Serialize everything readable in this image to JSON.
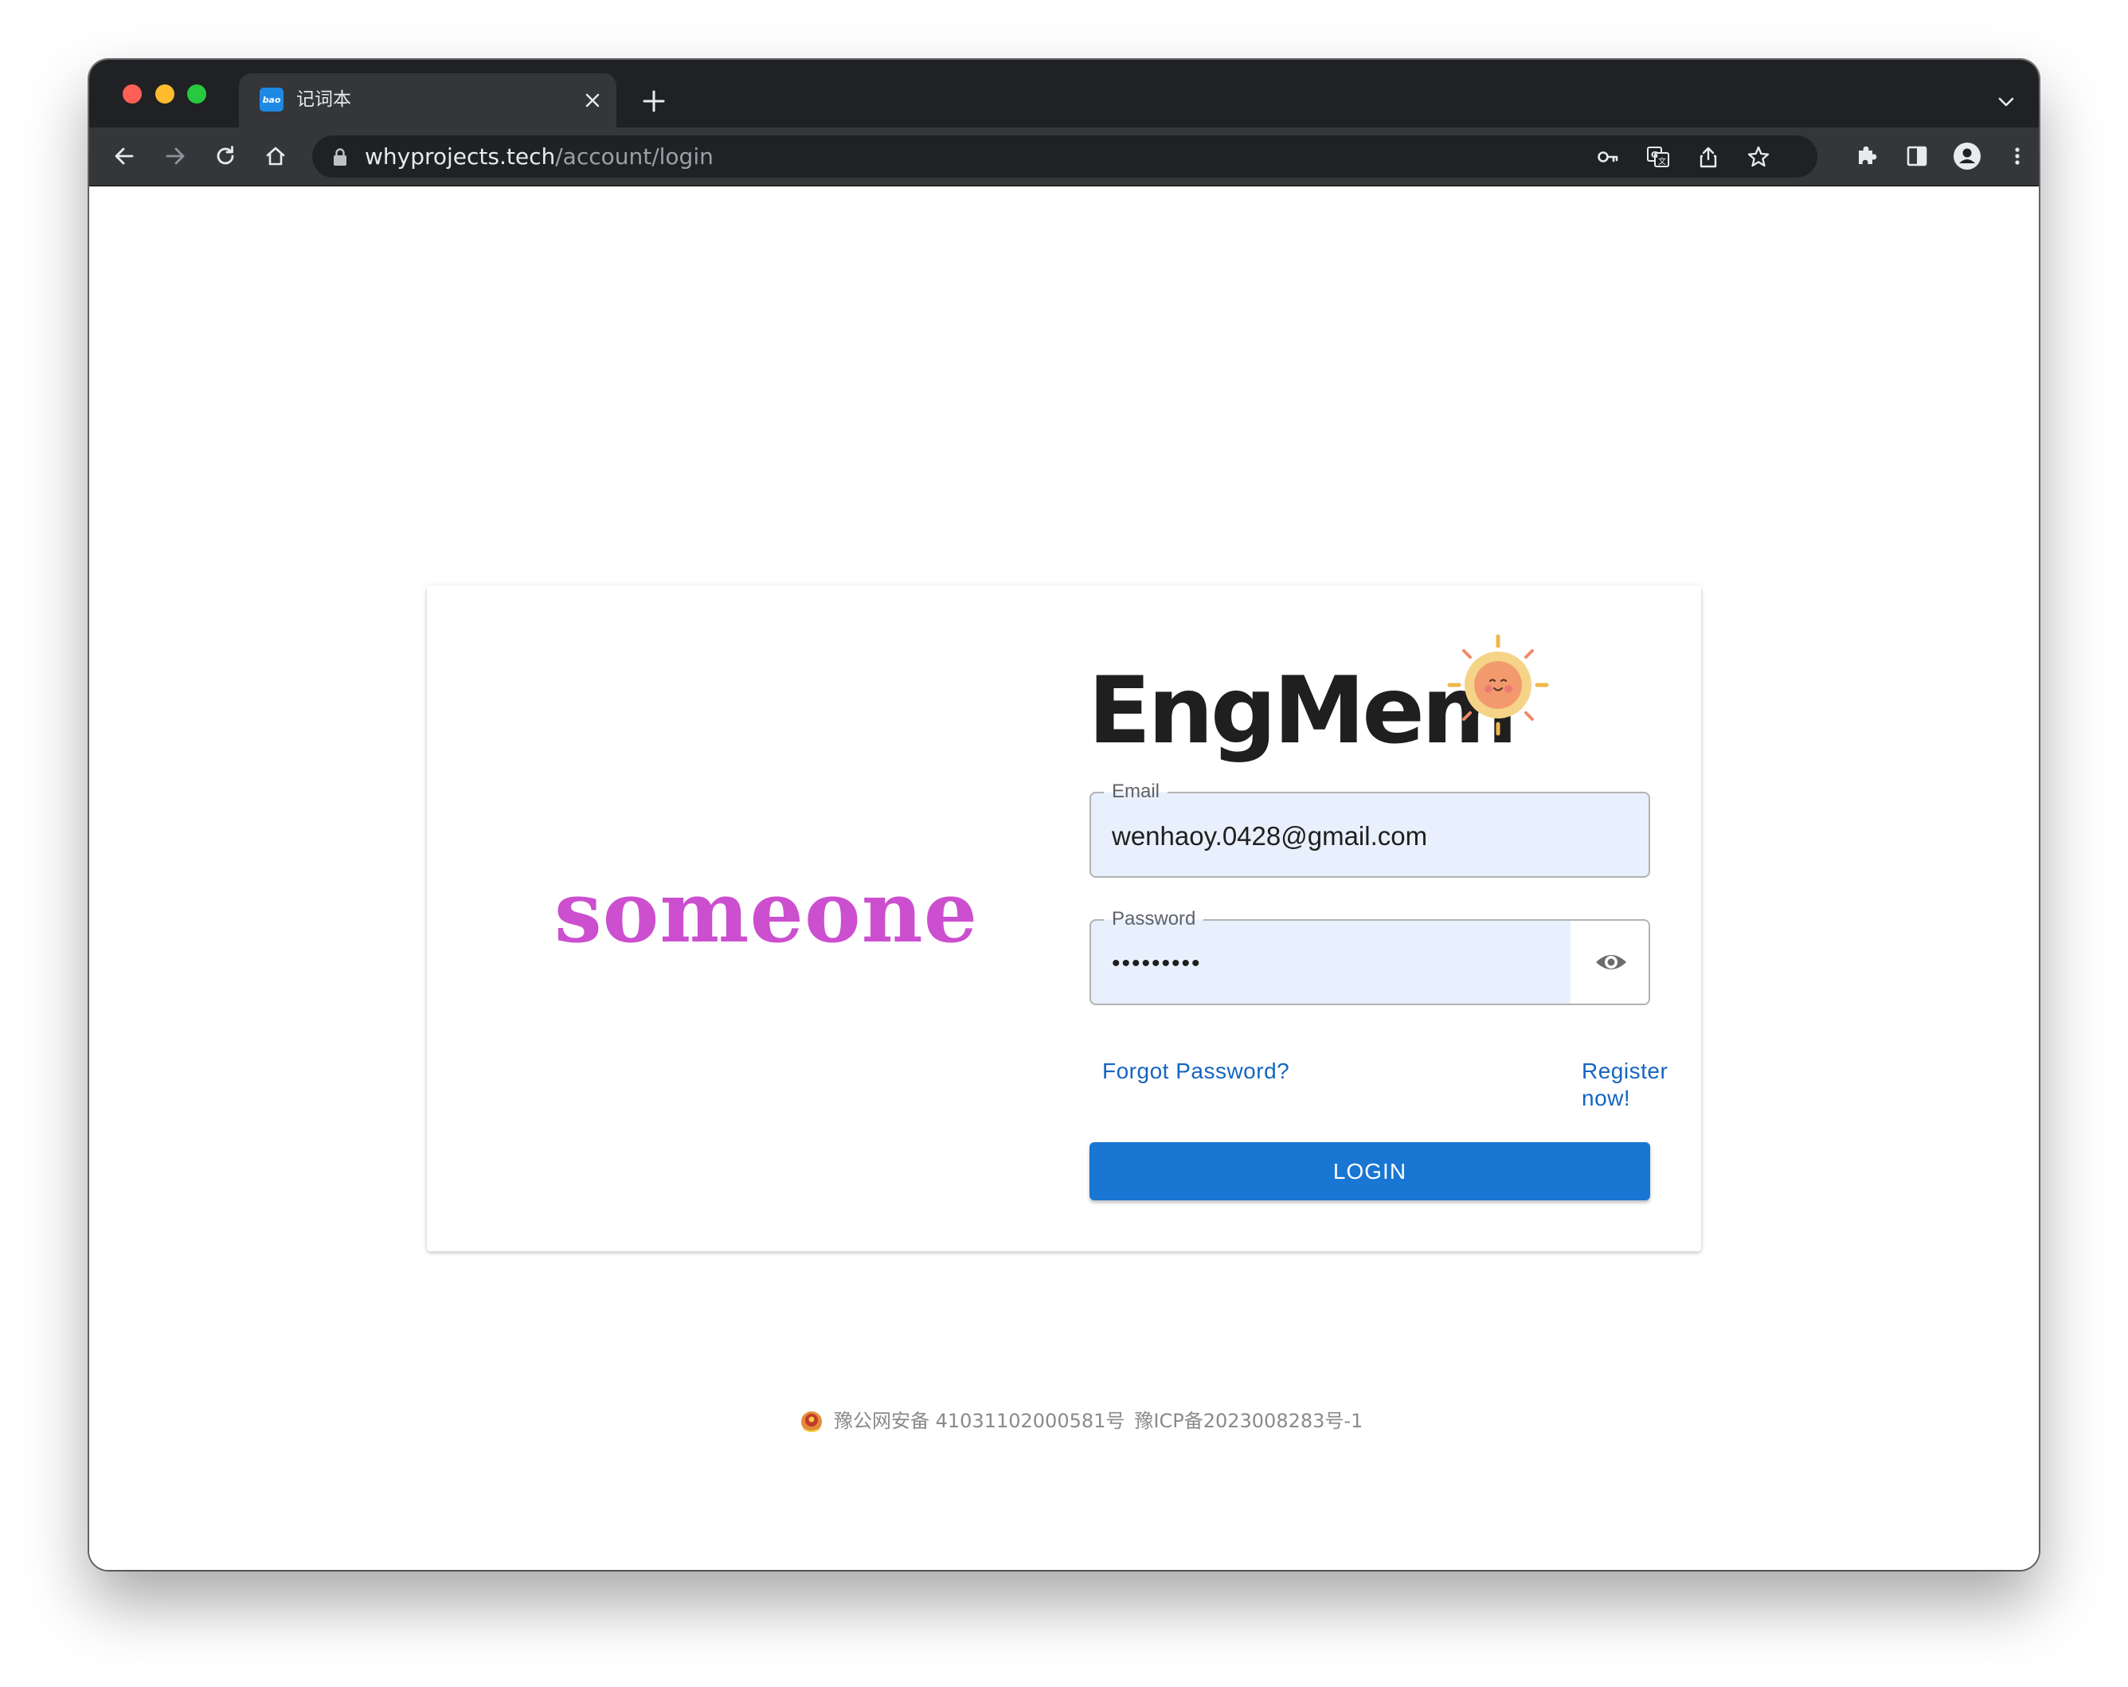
{
  "browser": {
    "tab": {
      "favicon_text": "bao",
      "title": "记词本"
    },
    "url": {
      "host": "whyprojects.tech",
      "path": "/account/login"
    }
  },
  "login": {
    "left_brand": "someone",
    "logo": "EngMem",
    "email": {
      "label": "Email",
      "value": "wenhaoy.0428@gmail.com"
    },
    "password": {
      "label": "Password",
      "masked_value": "•••••••••"
    },
    "forgot_link": "Forgot Password?",
    "register_link": "Register now!",
    "login_button": "LOGIN"
  },
  "footer": {
    "police_record": "豫公网安备 41031102000581号",
    "icp_record": "豫ICP备2023008283号-1"
  },
  "colors": {
    "accent": "#1976d2",
    "link": "#1565c0",
    "brand_magenta": "#cc4fcf",
    "field_fill": "#e8f0fe"
  }
}
